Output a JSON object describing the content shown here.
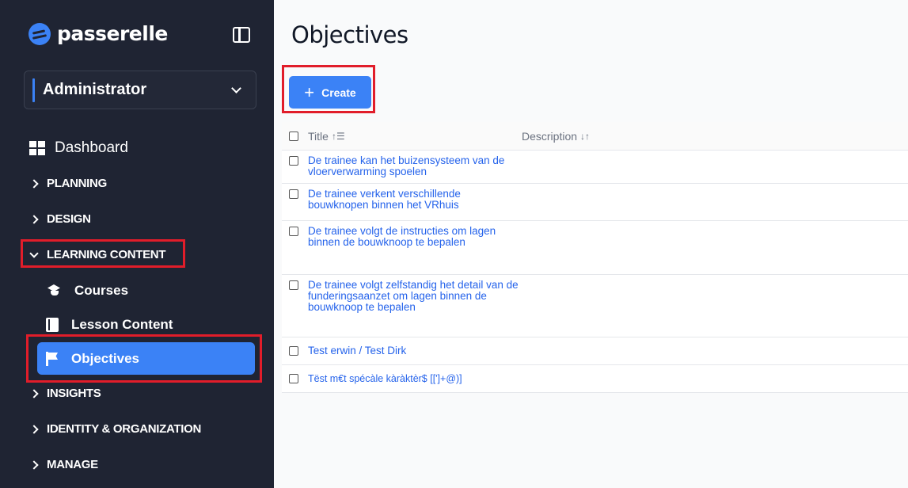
{
  "app": {
    "brand": "passerelle"
  },
  "role_select": {
    "value": "Administrator"
  },
  "nav": {
    "dashboard": "Dashboard",
    "planning": "PLANNING",
    "design": "DESIGN",
    "learning_content": "LEARNING CONTENT",
    "courses": "Courses",
    "lesson_content": "Lesson Content",
    "objectives": "Objectives",
    "insights": "INSIGHTS",
    "identity": "IDENTITY & ORGANIZATION",
    "manage": "MANAGE"
  },
  "page": {
    "title": "Objectives",
    "create_label": "Create"
  },
  "table": {
    "columns": {
      "title": "Title",
      "description": "Description"
    },
    "rows": [
      {
        "title": "De trainee kan het buizensysteem van de vloerverwarming spoelen",
        "description": ""
      },
      {
        "title": "De trainee verkent verschillende bouwknopen binnen het VRhuis",
        "description": ""
      },
      {
        "title": "De trainee volgt de instructies om lagen binnen de bouwknoop te bepalen",
        "description": ""
      },
      {
        "title": "De trainee volgt zelfstandig het detail van de funderingsaanzet om lagen binnen de bouwknoop te bepalen",
        "description": ""
      },
      {
        "title": "Test erwin / Test Dirk",
        "description": ""
      },
      {
        "title": "Tëst m€t spécàle kàràktèr$ [[']+@)]",
        "description": ""
      }
    ]
  },
  "colors": {
    "sidebar": "#1f2433",
    "accent": "#3b82f6",
    "highlight": "#e11d2a",
    "link": "#2563eb"
  }
}
